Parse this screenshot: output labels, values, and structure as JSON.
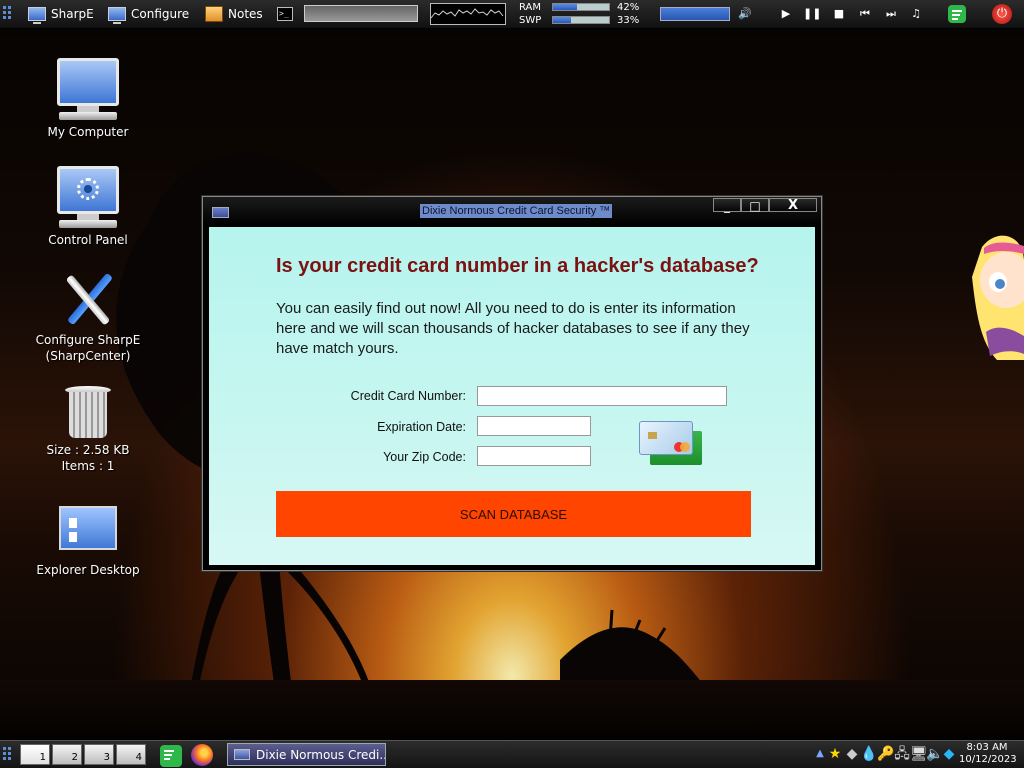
{
  "topbar": {
    "menu1": "SharpE",
    "menu2": "Configure",
    "menu3": "Notes",
    "ram_label": "RAM",
    "ram_value": "42%",
    "ram_fraction": 0.42,
    "swap_label": "SWP",
    "swap_value": "33%",
    "swap_fraction": 0.33
  },
  "desktop_icons": [
    {
      "label": "My Computer"
    },
    {
      "label": "Control Panel"
    },
    {
      "label": "Configure SharpE",
      "label2": "(SharpCenter)"
    },
    {
      "label": "Size : 2.58 KB",
      "label2": "Items : 1"
    },
    {
      "label": "Explorer Desktop"
    }
  ],
  "window": {
    "title": "Dixie Normous Credit Card Security ™",
    "minimize_label": "_",
    "maximize_label": "□",
    "close_label": "X",
    "headline": "Is your credit card number in a hacker's database?",
    "intro": "You can easily find out now! All you need to do is enter its information here and we will scan thousands of hacker databases to see if any they have match yours.",
    "fields": {
      "card_number_label": "Credit Card Number:",
      "card_number_value": "",
      "expiration_label": "Expiration Date:",
      "expiration_value": "",
      "zip_label": "Your Zip Code:",
      "zip_value": ""
    },
    "scan_button": "SCAN DATABASE"
  },
  "taskbar": {
    "workspaces": [
      "1",
      "2",
      "3",
      "4"
    ],
    "active_workspace": "1",
    "task_label": "Dixie Normous Credi...",
    "time": "8:03 AM",
    "date": "10/12/2023"
  },
  "icons": {
    "grip": "grip-icon",
    "monitor": "monitor-icon",
    "notes": "notes-icon",
    "terminal": "terminal-icon",
    "power": "power-icon",
    "firefox": "firefox-icon",
    "card": "credit-card-icon"
  }
}
